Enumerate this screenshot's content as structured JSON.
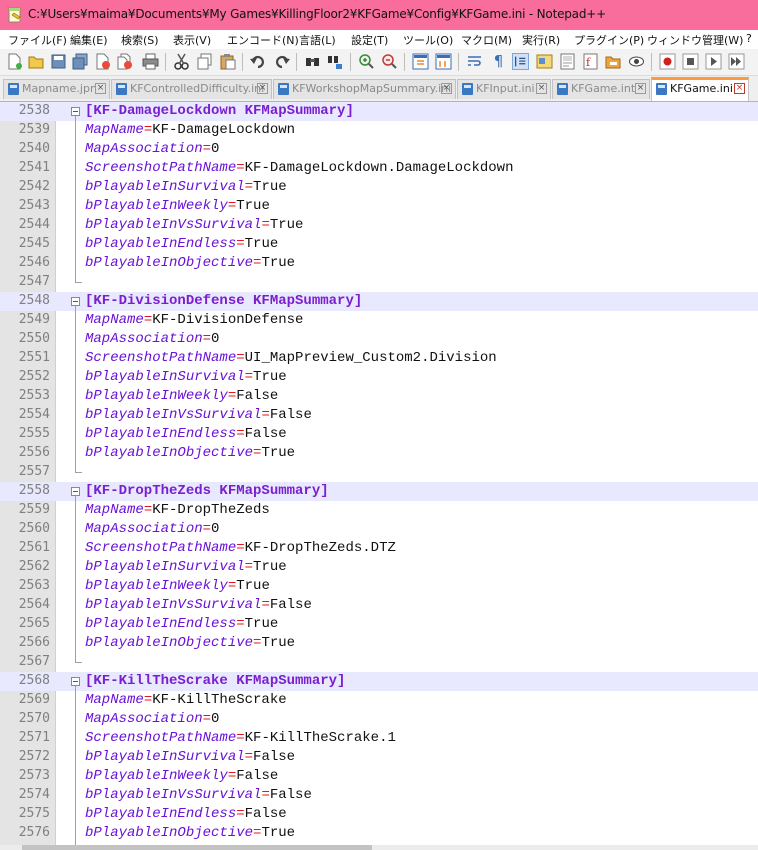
{
  "window": {
    "title": "C:¥Users¥maima¥Documents¥My Games¥KillingFloor2¥KFGame¥Config¥KFGame.ini - Notepad++"
  },
  "menu": [
    "ファイル(F)",
    "編集(E)",
    "検索(S)",
    "表示(V)",
    "エンコード(N)",
    "言語(L)",
    "設定(T)",
    "ツール(O)",
    "マクロ(M)",
    "実行(R)",
    "プラグイン(P)",
    "ウィンドウ管理(W)",
    "?"
  ],
  "toolbar": [
    "new-file",
    "open-file",
    "save",
    "save-all",
    "close",
    "close-all",
    "print",
    "cut",
    "copy",
    "paste",
    "undo",
    "redo",
    "find",
    "replace",
    "zoom-in",
    "zoom-out",
    "sync-vertical",
    "sync-horizontal",
    "word-wrap",
    "show-all-chars",
    "indent-guide",
    "user-defined-language",
    "document-map",
    "function-list",
    "folder-as-workspace",
    "monitoring",
    "record-macro",
    "stop-recording",
    "play-macro",
    "run-macro-multiple"
  ],
  "tabs": [
    {
      "label": "Mapname.jpn",
      "active": false
    },
    {
      "label": "KFControlledDifficulty.ini",
      "active": false
    },
    {
      "label": "KFWorkshopMapSummary.ini",
      "active": false
    },
    {
      "label": "KFInput.ini",
      "active": false
    },
    {
      "label": "KFGame.int",
      "active": false
    },
    {
      "label": "KFGame.ini",
      "active": true
    }
  ],
  "colors": {
    "titlebar": "#f96d9d",
    "section": "#7a1fcf",
    "key": "#6a12d6",
    "equals": "#e8141d",
    "highlight_line": "#e8e8ff",
    "active_tab_accent": "#fa9b3e"
  },
  "editor": {
    "lines": [
      {
        "num": "2538",
        "section": "[KF-DamageLockdown KFMapSummary]"
      },
      {
        "num": "2539",
        "key": "MapName",
        "value": "KF-DamageLockdown"
      },
      {
        "num": "2540",
        "key": "MapAssociation",
        "value": "0"
      },
      {
        "num": "2541",
        "key": "ScreenshotPathName",
        "value": "KF-DamageLockdown.DamageLockdown"
      },
      {
        "num": "2542",
        "key": "bPlayableInSurvival",
        "value": "True"
      },
      {
        "num": "2543",
        "key": "bPlayableInWeekly",
        "value": "True"
      },
      {
        "num": "2544",
        "key": "bPlayableInVsSurvival",
        "value": "True"
      },
      {
        "num": "2545",
        "key": "bPlayableInEndless",
        "value": "True"
      },
      {
        "num": "2546",
        "key": "bPlayableInObjective",
        "value": "True"
      },
      {
        "num": "2547",
        "blank": true
      },
      {
        "num": "2548",
        "section": "[KF-DivisionDefense KFMapSummary]"
      },
      {
        "num": "2549",
        "key": "MapName",
        "value": "KF-DivisionDefense"
      },
      {
        "num": "2550",
        "key": "MapAssociation",
        "value": "0"
      },
      {
        "num": "2551",
        "key": "ScreenshotPathName",
        "value": "UI_MapPreview_Custom2.Division"
      },
      {
        "num": "2552",
        "key": "bPlayableInSurvival",
        "value": "True"
      },
      {
        "num": "2553",
        "key": "bPlayableInWeekly",
        "value": "False"
      },
      {
        "num": "2554",
        "key": "bPlayableInVsSurvival",
        "value": "False"
      },
      {
        "num": "2555",
        "key": "bPlayableInEndless",
        "value": "False"
      },
      {
        "num": "2556",
        "key": "bPlayableInObjective",
        "value": "True"
      },
      {
        "num": "2557",
        "blank": true
      },
      {
        "num": "2558",
        "section": "[KF-DropTheZeds KFMapSummary]"
      },
      {
        "num": "2559",
        "key": "MapName",
        "value": "KF-DropTheZeds"
      },
      {
        "num": "2560",
        "key": "MapAssociation",
        "value": "0"
      },
      {
        "num": "2561",
        "key": "ScreenshotPathName",
        "value": "KF-DropTheZeds.DTZ"
      },
      {
        "num": "2562",
        "key": "bPlayableInSurvival",
        "value": "True"
      },
      {
        "num": "2563",
        "key": "bPlayableInWeekly",
        "value": "True"
      },
      {
        "num": "2564",
        "key": "bPlayableInVsSurvival",
        "value": "False"
      },
      {
        "num": "2565",
        "key": "bPlayableInEndless",
        "value": "True"
      },
      {
        "num": "2566",
        "key": "bPlayableInObjective",
        "value": "True"
      },
      {
        "num": "2567",
        "blank": true
      },
      {
        "num": "2568",
        "section": "[KF-KillTheScrake KFMapSummary]"
      },
      {
        "num": "2569",
        "key": "MapName",
        "value": "KF-KillTheScrake"
      },
      {
        "num": "2570",
        "key": "MapAssociation",
        "value": "0"
      },
      {
        "num": "2571",
        "key": "ScreenshotPathName",
        "value": "KF-KillTheScrake.1"
      },
      {
        "num": "2572",
        "key": "bPlayableInSurvival",
        "value": "False"
      },
      {
        "num": "2573",
        "key": "bPlayableInWeekly",
        "value": "False"
      },
      {
        "num": "2574",
        "key": "bPlayableInVsSurvival",
        "value": "False"
      },
      {
        "num": "2575",
        "key": "bPlayableInEndless",
        "value": "False"
      },
      {
        "num": "2576",
        "key": "bPlayableInObjective",
        "value": "True"
      }
    ]
  }
}
